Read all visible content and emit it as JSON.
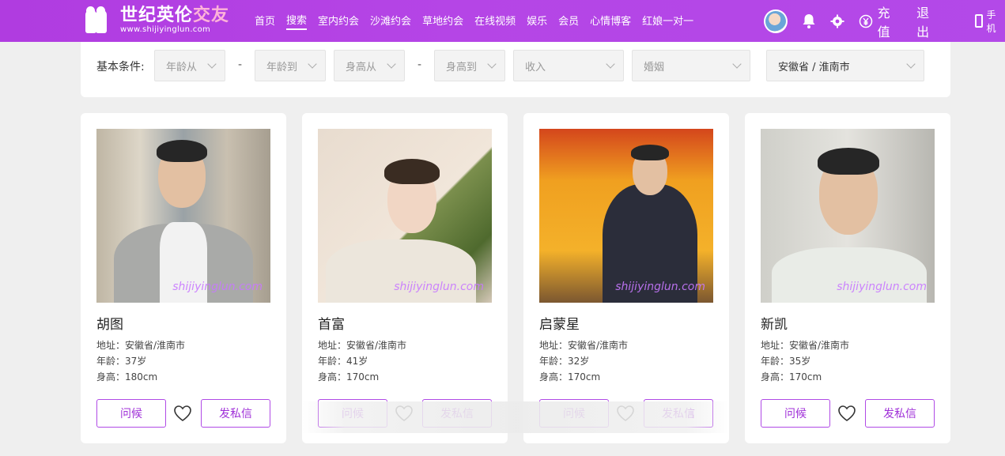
{
  "header": {
    "logo_title_main": "世纪英伦",
    "logo_title_accent": "交友",
    "logo_url": "www.shijiyinglun.com",
    "nav": [
      "首页",
      "搜索",
      "室内约会",
      "沙滩约会",
      "草地约会",
      "在线视频",
      "娱乐",
      "会员",
      "心情博客",
      "红娘一对一"
    ],
    "active_nav_index": 1,
    "recharge_label": "充值",
    "logout_label": "退出",
    "mobile_label": "手机"
  },
  "filter": {
    "label": "基本条件:",
    "age_from": "年龄从",
    "age_to": "年龄到",
    "height_from": "身高从",
    "height_to": "身高到",
    "income": "收入",
    "marriage": "婚姻",
    "region": "安徽省 / 淮南市",
    "separator": "-"
  },
  "cards": [
    {
      "name": "胡图",
      "address": "地址：安徽省/淮南市",
      "age": "年龄：37岁",
      "height": "身高：180cm",
      "watermark": "shijiyinglun.com"
    },
    {
      "name": "首富",
      "address": "地址：安徽省/淮南市",
      "age": "年龄：41岁",
      "height": "身高：170cm",
      "watermark": "shijiyinglun.com"
    },
    {
      "name": "启蒙星",
      "address": "地址：安徽省/淮南市",
      "age": "年龄：32岁",
      "height": "身高：170cm",
      "watermark": "shijiyinglun.com"
    },
    {
      "name": "新凯",
      "address": "地址：安徽省/淮南市",
      "age": "年龄：35岁",
      "height": "身高：170cm",
      "watermark": "shijiyinglun.com"
    }
  ],
  "buttons": {
    "greet": "问候",
    "message": "发私信"
  },
  "colors": {
    "brand": "#b545e6",
    "button_border": "#b04ae6",
    "button_text": "#a030d8"
  },
  "icons": [
    "bell-icon",
    "gear-icon",
    "yen-icon",
    "phone-icon",
    "heart-icon",
    "chevron-down-icon"
  ]
}
